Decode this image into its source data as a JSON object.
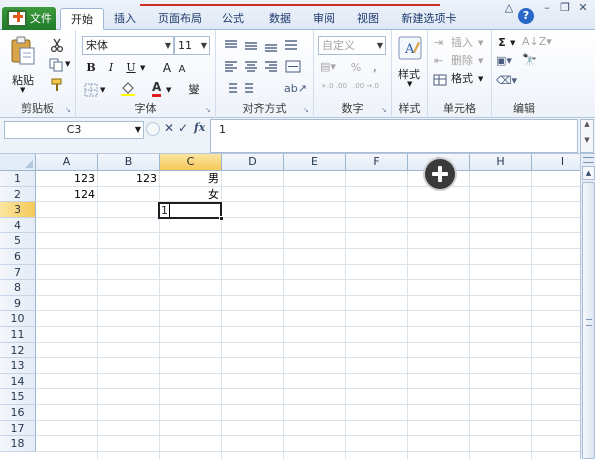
{
  "tabs": {
    "file": "文件",
    "items": [
      "开始",
      "插入",
      "页面布局",
      "公式",
      "数据",
      "审阅",
      "视图",
      "新建选项卡"
    ],
    "active": 0
  },
  "window_controls": {
    "collapse": "△",
    "help": "?",
    "minimize": "–",
    "restore": "❐",
    "close": "✕"
  },
  "ribbon": {
    "clipboard": {
      "label": "剪贴板",
      "paste": "粘贴",
      "cut_icon": "scissors-icon",
      "copy_icon": "copy-icon",
      "format_painter_icon": "brush-icon"
    },
    "font": {
      "label": "字体",
      "font_name": "宋体",
      "font_size": "11",
      "bold": "B",
      "italic": "I",
      "underline": "U",
      "grow": "A",
      "shrink": "A",
      "phonetic": "燮"
    },
    "alignment": {
      "label": "对齐方式"
    },
    "number": {
      "label": "数字",
      "format": "自定义",
      "percent": "%",
      "comma": ",",
      "inc_decimal": "+.0 .00",
      "dec_decimal": ".00 →.0"
    },
    "styles": {
      "label": "样式",
      "button": "样式"
    },
    "cells": {
      "label": "单元格",
      "insert": "插入",
      "delete": "删除",
      "format": "格式"
    },
    "editing": {
      "label": "编辑",
      "sigma": "Σ"
    }
  },
  "formula_bar": {
    "name_box": "C3",
    "fx": "fx",
    "content": "1"
  },
  "sheet": {
    "columns": [
      "A",
      "B",
      "C",
      "D",
      "E",
      "F",
      "G",
      "H",
      "I"
    ],
    "selected_column": "C",
    "rows": [
      "1",
      "2",
      "3",
      "4",
      "5",
      "6",
      "7",
      "8",
      "9",
      "10",
      "11",
      "12",
      "13",
      "14",
      "15",
      "16",
      "17",
      "18"
    ],
    "selected_row": "3",
    "cells": {
      "A1": "123",
      "B1": "123",
      "C1": "男",
      "A2": "124",
      "C2": "女",
      "C3": "1"
    }
  }
}
